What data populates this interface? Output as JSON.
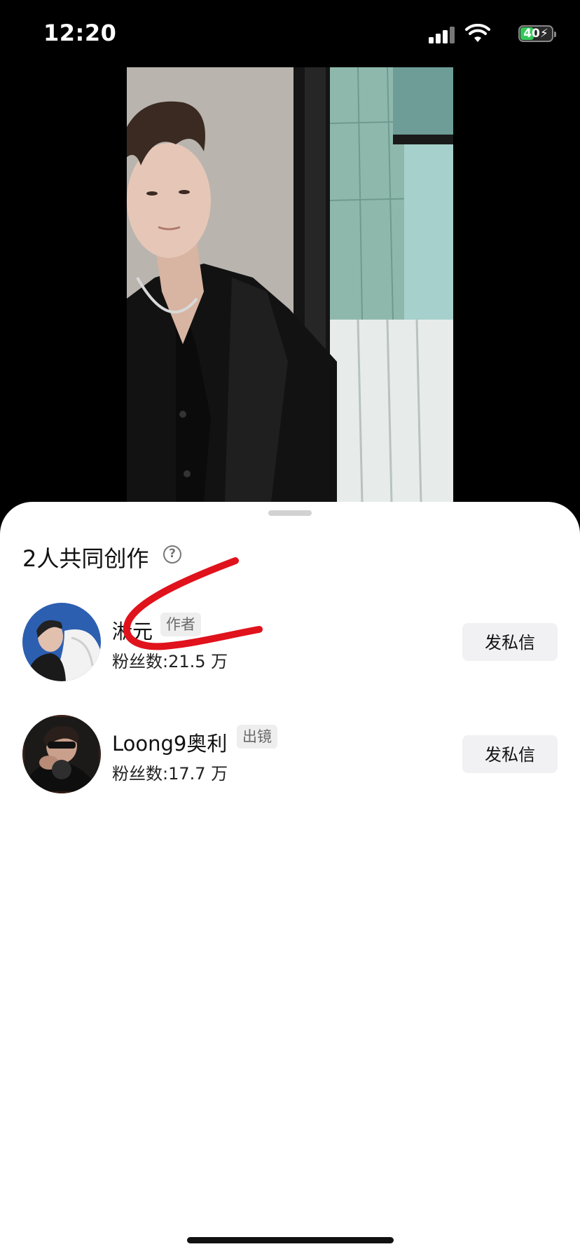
{
  "status_bar": {
    "time": "12:20",
    "battery": "40",
    "icons": [
      "signal-icon",
      "wifi-icon",
      "battery-charging-icon"
    ]
  },
  "video": {
    "description_icon": "video-frame"
  },
  "sheet": {
    "title": "2人共同创作",
    "help_icon": "?",
    "creators": [
      {
        "name": "淅元",
        "role_tag": "作者",
        "fans": "粉丝数:21.5 万",
        "button": "发私信"
      },
      {
        "name": "Loong9奥利",
        "role_tag": "出镜",
        "fans": "粉丝数:17.7 万",
        "button": "发私信"
      }
    ]
  },
  "colors": {
    "annotation_red": "#e0121c",
    "battery_green": "#34c759"
  }
}
